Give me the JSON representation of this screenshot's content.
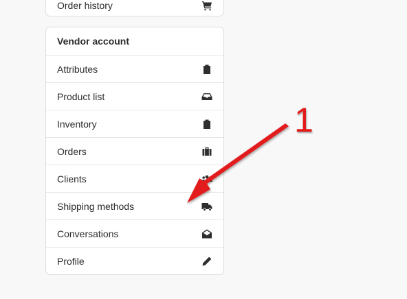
{
  "top_menu": {
    "items": [
      {
        "label": "Order history",
        "icon": "cart-icon"
      }
    ]
  },
  "vendor_menu": {
    "header": "Vendor account",
    "items": [
      {
        "label": "Attributes",
        "icon": "clipboard-icon"
      },
      {
        "label": "Product list",
        "icon": "inbox-icon"
      },
      {
        "label": "Inventory",
        "icon": "clipboard-icon"
      },
      {
        "label": "Orders",
        "icon": "suitcase-icon"
      },
      {
        "label": "Clients",
        "icon": "users-icon"
      },
      {
        "label": "Shipping methods",
        "icon": "truck-icon"
      },
      {
        "label": "Conversations",
        "icon": "envelope-open-icon"
      },
      {
        "label": "Profile",
        "icon": "pencil-icon"
      }
    ]
  },
  "annotation": {
    "number": "1",
    "color": "#e21b1b"
  },
  "colors": {
    "background": "#f8f8f9",
    "card": "#ffffff",
    "border": "#dedede"
  }
}
